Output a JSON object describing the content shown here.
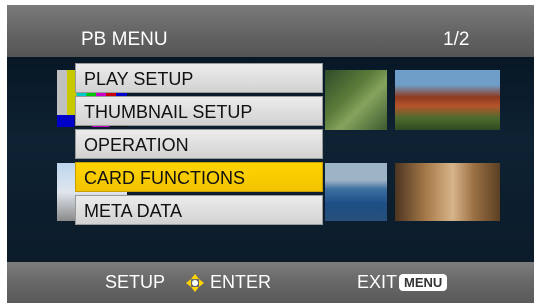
{
  "header": {
    "title": "PB MENU",
    "page": "1/2"
  },
  "menu": {
    "items": [
      {
        "label": "PLAY SETUP",
        "selected": false
      },
      {
        "label": "THUMBNAIL SETUP",
        "selected": false
      },
      {
        "label": "OPERATION",
        "selected": false
      },
      {
        "label": "CARD FUNCTIONS",
        "selected": true
      },
      {
        "label": "META DATA",
        "selected": false
      }
    ]
  },
  "footer": {
    "setup_label": "SETUP",
    "enter_label": "ENTER",
    "exit_label": "EXIT",
    "menu_key_label": "MENU"
  },
  "colors": {
    "selected_item": "#ffd400",
    "menu_item": "#e0e0e0",
    "bar": "#666666"
  },
  "icons": {
    "dpad": "dpad-icon"
  }
}
